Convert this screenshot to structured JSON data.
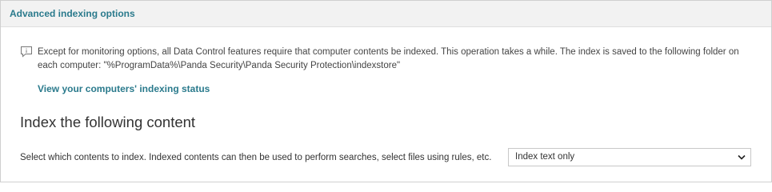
{
  "panel": {
    "title": "Advanced indexing options"
  },
  "info": {
    "icon": "info-icon",
    "text": "Except for monitoring options, all Data Control features require that computer contents be indexed. This operation takes a while. The index is saved to the following folder on each computer: \"%ProgramData%\\Panda Security\\Panda Security Protection\\indexstore\"",
    "link_label": "View your computers' indexing status"
  },
  "index_section": {
    "heading": "Index the following content",
    "select_label": "Select which contents to index. Indexed contents can then be used to perform searches, select files using rules, etc.",
    "selected_value": "Index text only",
    "dropdown_icon": "chevron-down-icon"
  },
  "colors": {
    "accent": "#2a7a8c",
    "header_bg": "#f2f2f2",
    "border": "#cfcfcf"
  }
}
